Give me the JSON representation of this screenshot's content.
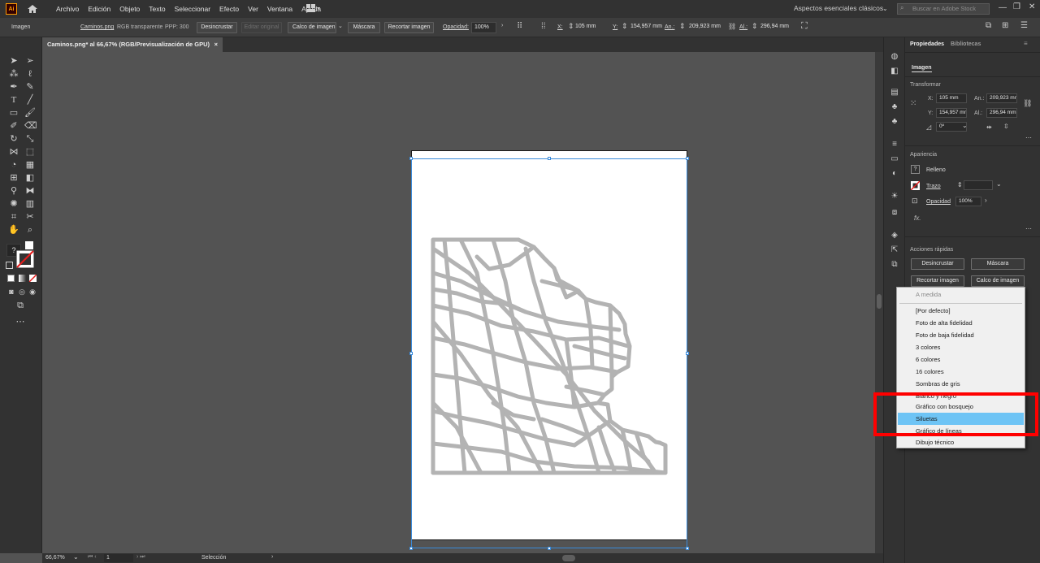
{
  "app": {
    "logo": "Ai",
    "workspace": "Aspectos esenciales clásicos",
    "stock_placeholder": "Buscar en Adobe Stock"
  },
  "menu": [
    "Archivo",
    "Edición",
    "Objeto",
    "Texto",
    "Seleccionar",
    "Efecto",
    "Ver",
    "Ventana",
    "Ayuda"
  ],
  "control": {
    "object_type": "Imagen",
    "filename": "Caminos.png",
    "color_mode": "RGB transparente",
    "ppp": "PPP: 300",
    "embed_label": "Desincrustar",
    "edit_original_label": "Editar original",
    "trace_label": "Calco de imagen",
    "mask_label": "Máscara",
    "crop_label": "Recortar imagen",
    "opacity_label": "Opacidad:",
    "opacity_value": "100%",
    "x_label": "X:",
    "x_value": "105 mm",
    "y_label": "Y:",
    "y_value": "154,957 mm",
    "w_label": "An.:",
    "w_value": "209,923 mm",
    "h_label": "Al.:",
    "h_value": "296,94 mm"
  },
  "doc_tab": {
    "title": "Caminos.png* al 66,67% (RGB/Previsualización de GPU)",
    "close": "×"
  },
  "status": {
    "zoom": "66,67%",
    "artboard": "1",
    "tool": "Selección"
  },
  "toolbar": {
    "help": "?"
  },
  "props": {
    "tab_properties": "Propiedades",
    "tab_libraries": "Bibliotecas",
    "section_image": "Imagen",
    "transform_title": "Transformar",
    "x_label": "X:",
    "x_value": "105 mm",
    "y_label": "Y:",
    "y_value": "154,957 mm",
    "w_label": "An.:",
    "w_value": "209,923 mr",
    "h_label": "Al.:",
    "h_value": "296,94 mm",
    "angle_value": "0º",
    "appearance_title": "Apariencia",
    "fill_label": "Relleno",
    "stroke_label": "Trazo",
    "opacity_label": "Opacidad",
    "opacity_value": "100%",
    "fx": "fx.",
    "quick_actions_title": "Acciones rápidas",
    "btn_embed": "Desincrustar",
    "btn_mask": "Máscara",
    "btn_crop": "Recortar imagen",
    "btn_trace": "Calco de imagen"
  },
  "dropdown": {
    "header": "A medida",
    "items": [
      "[Por defecto]",
      "Foto de alta fidelidad",
      "Foto de baja fidelidad",
      "3 colores",
      "6 colores",
      "16 colores",
      "Sombras de gris",
      "Blanco y negro",
      "Gráfico con bosquejo",
      "Siluetas",
      "Gráfico de líneas",
      "Dibujo técnico"
    ],
    "selected": "Siluetas"
  },
  "colors": {
    "accent": "#3a8bdb",
    "highlight": "#ff0000",
    "selected_item": "#6ec4f5",
    "map_roads": "#b3b3b3"
  }
}
